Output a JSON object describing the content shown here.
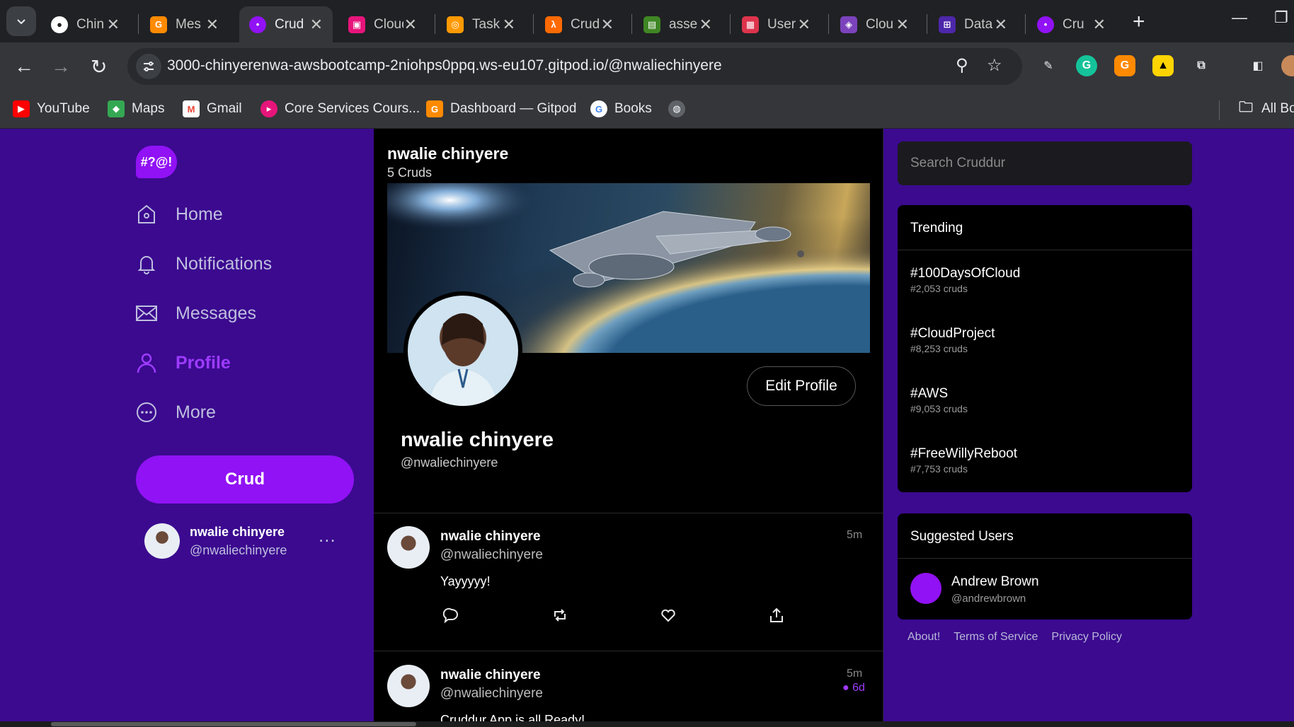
{
  "browser": {
    "tabs": [
      {
        "label": "Chin",
        "favicon": "github-icon",
        "color": "#202124"
      },
      {
        "label": "Mes",
        "favicon": "gitpod-icon",
        "color": "#ff8a00"
      },
      {
        "label": "Cruddur",
        "favicon": "cruddur-icon",
        "color": "#9112f5",
        "active": true
      },
      {
        "label": "Cloud",
        "favicon": "cloud-icon",
        "color": "#e7157b"
      },
      {
        "label": "Task",
        "favicon": "task-icon",
        "color": "#ff9900"
      },
      {
        "label": "Crud",
        "favicon": "aws-icon",
        "color": "#ff6a00"
      },
      {
        "label": "asse",
        "favicon": "assets-icon",
        "color": "#3f8624"
      },
      {
        "label": "User",
        "favicon": "user-icon",
        "color": "#dd344c"
      },
      {
        "label": "Clou",
        "favicon": "cloudwatch-icon",
        "color": "#7b42bc"
      },
      {
        "label": "Data",
        "favicon": "database-icon",
        "color": "#4d27aa"
      },
      {
        "label": "Cru",
        "favicon": "cruddur-icon",
        "color": "#9112f5"
      }
    ],
    "url": "3000-chinyerenwa-awsbootcamp-2niohps0ppq.ws-eu107.gitpod.io/@nwaliechinyere",
    "bookmarks": [
      {
        "label": "YouTube",
        "icon": "youtube-icon",
        "color": "#ff0000"
      },
      {
        "label": "Maps",
        "icon": "maps-icon",
        "color": "#34a853"
      },
      {
        "label": "Gmail",
        "icon": "gmail-icon",
        "color": "#ea4335"
      },
      {
        "label": "Core Services Cours...",
        "icon": "course-icon",
        "color": "#e7157b"
      },
      {
        "label": "Dashboard — Gitpod",
        "icon": "gitpod-icon",
        "color": "#ff8a00"
      },
      {
        "label": "Books",
        "icon": "google-icon",
        "color": "#4285f4"
      }
    ],
    "all_bookmarks": "All Bo"
  },
  "sidebar": {
    "logo": "#?@!",
    "items": [
      {
        "label": "Home",
        "icon": "home-icon"
      },
      {
        "label": "Notifications",
        "icon": "bell-icon"
      },
      {
        "label": "Messages",
        "icon": "envelope-icon"
      },
      {
        "label": "Profile",
        "icon": "person-icon",
        "active": true
      },
      {
        "label": "More",
        "icon": "more-circle-icon"
      }
    ],
    "crud_button": "Crud",
    "current_user": {
      "name": "nwalie chinyere",
      "handle": "@nwaliechinyere",
      "menu": "..."
    }
  },
  "profile": {
    "header_name": "nwalie chinyere",
    "crud_count": "5 Cruds",
    "name": "nwalie chinyere",
    "handle": "@nwaliechinyere",
    "edit_button": "Edit Profile"
  },
  "posts": [
    {
      "name": "nwalie chinyere",
      "handle": "@nwaliechinyere",
      "time": "5m",
      "body": "Yayyyyy!",
      "expires": ""
    },
    {
      "name": "nwalie chinyere",
      "handle": "@nwaliechinyere",
      "time": "5m",
      "body": "Cruddur App is all Ready!",
      "expires": "6d"
    }
  ],
  "search": {
    "placeholder": "Search Cruddur"
  },
  "trending": {
    "title": "Trending",
    "items": [
      {
        "tag": "#100DaysOfCloud",
        "count": "#2,053 cruds"
      },
      {
        "tag": "#CloudProject",
        "count": "#8,253 cruds"
      },
      {
        "tag": "#AWS",
        "count": "#9,053 cruds"
      },
      {
        "tag": "#FreeWillyReboot",
        "count": "#7,753 cruds"
      }
    ]
  },
  "suggested": {
    "title": "Suggested Users",
    "users": [
      {
        "name": "Andrew Brown",
        "handle": "@andrewbrown"
      }
    ]
  },
  "footer": {
    "about": "About!",
    "terms": "Terms of Service",
    "privacy": "Privacy Policy"
  }
}
